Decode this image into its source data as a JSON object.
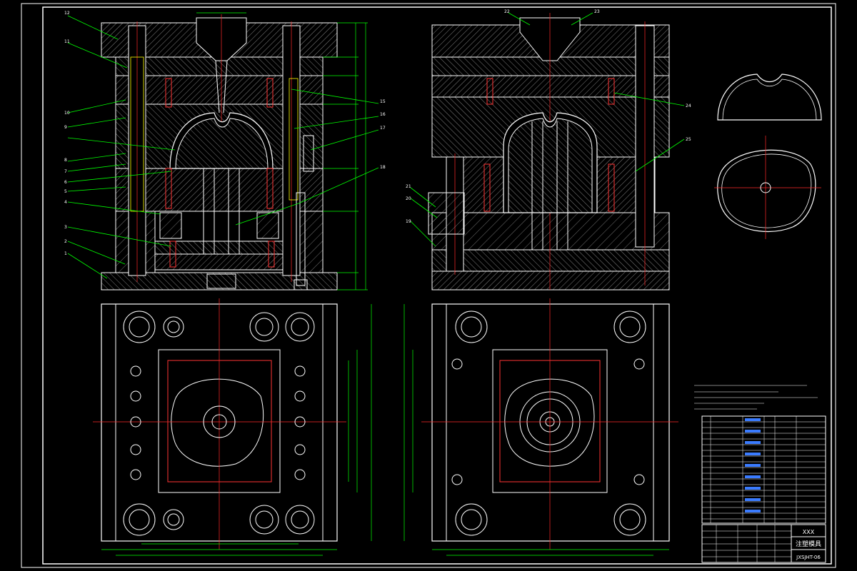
{
  "title_block": {
    "company": "XXX",
    "drawing_title": "注塑模具",
    "drawing_number": "JXSJHT-06"
  },
  "part_labels_left": [
    "12",
    "11",
    "10",
    "9",
    "8",
    "7",
    "6",
    "5",
    "4",
    "3",
    "2",
    "1"
  ],
  "part_labels_right_of_left_view": [
    "15",
    "16",
    "17",
    "18"
  ],
  "part_labels_right_view": [
    "22",
    "23",
    "24",
    "25",
    "21",
    "20",
    "19"
  ],
  "colors": {
    "background": "#000000",
    "frame": "#ffffff",
    "leader": "#00ff00",
    "centerline": "#ff2a2a",
    "hidden": "#ffff00",
    "pin": "#ff00ff"
  }
}
